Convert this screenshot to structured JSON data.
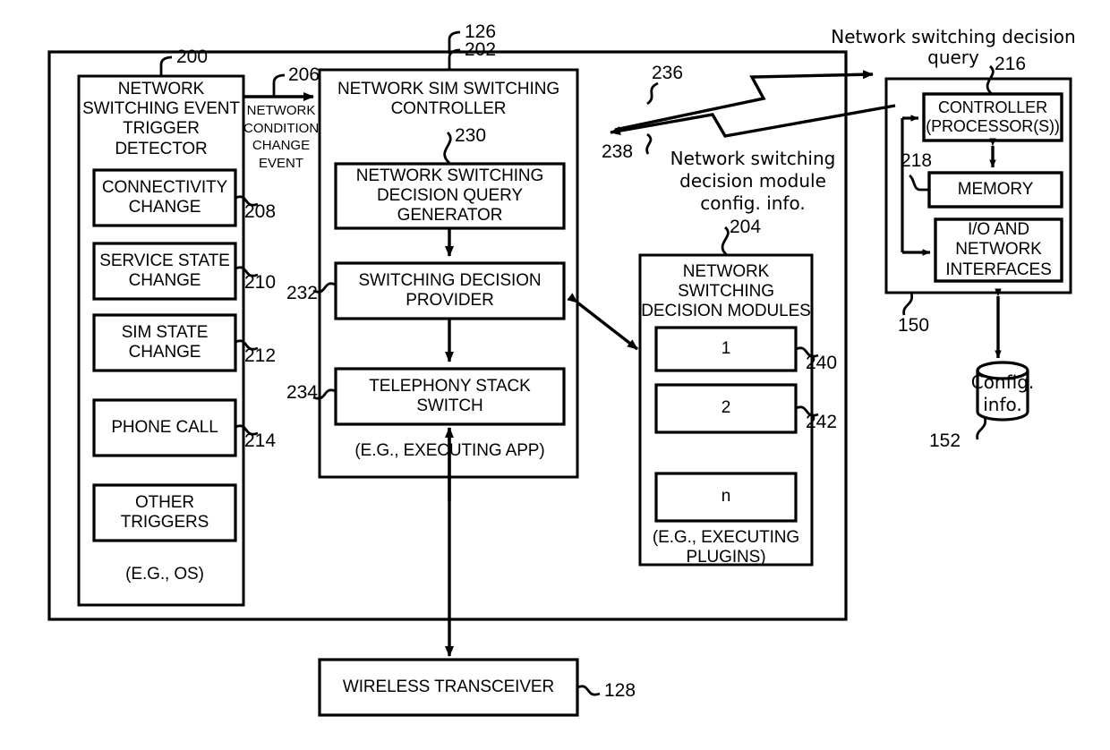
{
  "figure": {
    "type": "patent-block-diagram",
    "reference_numerals": {
      "device": "126",
      "trigger_detector": "200",
      "network_condition_change_event": "206",
      "connectivity_change": "208",
      "service_state_change": "210",
      "sim_state_change": "212",
      "phone_call": "214",
      "sim_switching_controller": "202",
      "query_generator": "230",
      "switching_decision_provider": "232",
      "telephony_stack_switch": "234",
      "decision_modules": "204",
      "module_1": "240",
      "module_2": "242",
      "query_link": "236",
      "config_link": "238",
      "server": "150",
      "controller_processors": "216",
      "memory": "218",
      "config_info_store": "152",
      "wireless_transceiver": "128"
    }
  },
  "device": {
    "ref": "126"
  },
  "trigger_detector": {
    "ref": "200",
    "title": "NETWORK\nSWITCHING EVENT\nTRIGGER\nDETECTOR",
    "footer": "(E.G., OS)",
    "items": [
      {
        "label": "CONNECTIVITY\nCHANGE",
        "ref": "208"
      },
      {
        "label": "SERVICE STATE\nCHANGE",
        "ref": "210"
      },
      {
        "label": "SIM STATE\nCHANGE",
        "ref": "212"
      },
      {
        "label": "PHONE CALL",
        "ref": "214"
      },
      {
        "label": "OTHER\nTRIGGERS",
        "ref": ""
      }
    ]
  },
  "event_arrow": {
    "ref": "206",
    "label": "NETWORK\nCONDITION\nCHANGE\nEVENT"
  },
  "sim_switching_controller": {
    "ref": "202",
    "title": "NETWORK SIM SWITCHING\nCONTROLLER",
    "footer": "(E.G., EXECUTING APP)",
    "blocks": [
      {
        "label": "NETWORK SWITCHING\nDECISION QUERY\nGENERATOR",
        "ref": "230"
      },
      {
        "label": "SWITCHING DECISION\nPROVIDER",
        "ref": "232"
      },
      {
        "label": "TELEPHONY STACK SWITCH",
        "ref": "234"
      }
    ]
  },
  "decision_modules": {
    "ref": "204",
    "title": "NETWORK\nSWITCHING\nDECISION MODULES",
    "footer": "(E.G., EXECUTING\nPLUGINS)",
    "items": [
      {
        "label": "1",
        "ref": "240"
      },
      {
        "label": "2",
        "ref": "242"
      },
      {
        "label": "n",
        "ref": ""
      }
    ]
  },
  "links": {
    "query": {
      "ref": "236",
      "label": "Network switching decision\nquery"
    },
    "config": {
      "ref": "238",
      "label": "Network switching\ndecision module\nconfig. info."
    }
  },
  "server": {
    "ref": "150",
    "blocks": [
      {
        "label": "CONTROLLER\n(PROCESSOR(S))",
        "ref": "216"
      },
      {
        "label": "MEMORY",
        "ref": "218"
      },
      {
        "label": "I/O AND\nNETWORK\nINTERFACES",
        "ref": ""
      }
    ]
  },
  "config_store": {
    "ref": "152",
    "label": "Config.\ninfo."
  },
  "wireless_transceiver": {
    "ref": "128",
    "label": "WIRELESS TRANSCEIVER"
  }
}
